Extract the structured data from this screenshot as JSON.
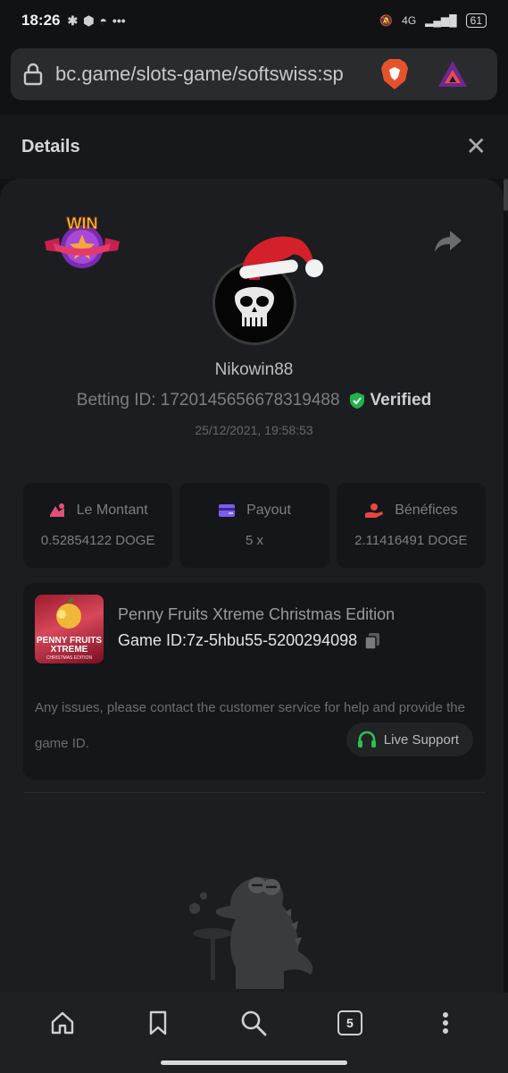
{
  "status": {
    "time": "18:26",
    "battery": "61",
    "network": "4G"
  },
  "browser": {
    "url": "bc.game/slots-game/softswiss:sp",
    "open_tabs": "5"
  },
  "details": {
    "title": "Details"
  },
  "badge": {
    "text": "WIN"
  },
  "player": {
    "username": "Nikowin88",
    "betting_id": "Betting ID: 1720145656678319488",
    "verified_label": "Verified",
    "timestamp": "25/12/2021, 19:58:53"
  },
  "stats": [
    {
      "label": "Le Montant",
      "value": "0.52854122 DOGE",
      "icon": "coins-icon",
      "color": "#e24f79"
    },
    {
      "label": "Payout",
      "value": "5 x",
      "icon": "wallet-icon",
      "color": "#7b5cf0"
    },
    {
      "label": "Bénéfices",
      "value": "2.11416491 DOGE",
      "icon": "hand-coin-icon",
      "color": "#e5473f"
    }
  ],
  "game": {
    "name": "Penny Fruits Xtreme Christmas Edition",
    "game_id": "Game ID:7z-5hbu55-5200294098",
    "thumb_title": "PENNY FRUITS XTREME",
    "thumb_subtitle": "CHRISTMAS EDITION",
    "issues_text": "Any issues, please contact the customer service for help and provide the game ID.",
    "support_label": "Live Support"
  },
  "colors": {
    "verified": "#22b34c",
    "support_icon": "#2fbf4a"
  }
}
